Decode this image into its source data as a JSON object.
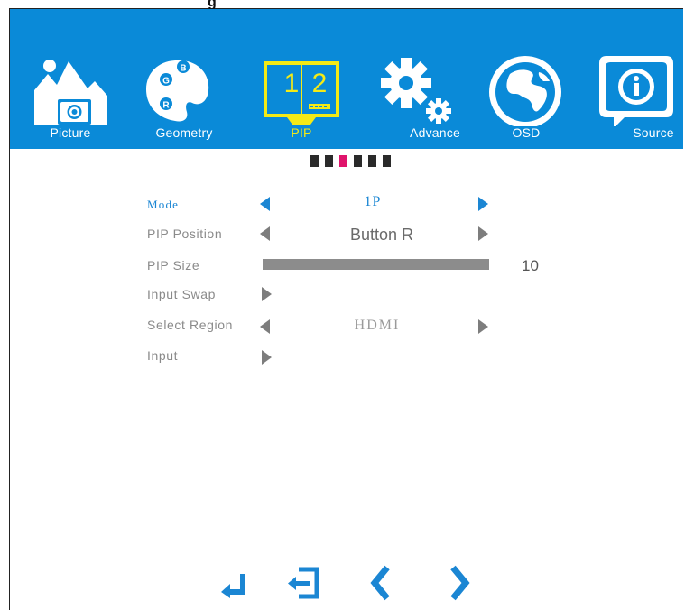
{
  "header": {
    "cropped_caption": "g"
  },
  "tabs": [
    {
      "label": "Picture",
      "icon": "mountain-camera-icon",
      "active": false
    },
    {
      "label": "Geometry",
      "icon": "palette-icon",
      "active": false
    },
    {
      "label": "PIP",
      "icon": "pip-screen-icon",
      "active": true,
      "screen_labels": [
        "1",
        "2"
      ]
    },
    {
      "label": "Advance",
      "icon": "gear-icon",
      "active": false
    },
    {
      "label": "OSD",
      "icon": "globe-icon",
      "active": false
    },
    {
      "label": "Source",
      "icon": "info-bubble-icon",
      "active": false
    }
  ],
  "page_indicator": {
    "count": 6,
    "active_index": 2
  },
  "settings": {
    "mode": {
      "label": "Mode",
      "value": "1P"
    },
    "pip_position": {
      "label": "PIP Position",
      "value": "Button R"
    },
    "pip_size": {
      "label": "PIP Size",
      "value": "10",
      "fill_fraction": 1.0
    },
    "input_swap": {
      "label": "Input Swap"
    },
    "select_region": {
      "label": "Select Region",
      "value": "HDMI"
    },
    "input": {
      "label": "Input"
    }
  },
  "palette": {
    "bar": "#0a8ad8",
    "active_tab": "#f4ea16",
    "accent": "#1b86d3",
    "indicator": "#e0146c"
  },
  "nav_icons": [
    "enter-icon",
    "exit-icon",
    "left-chevron-icon",
    "right-chevron-icon"
  ]
}
